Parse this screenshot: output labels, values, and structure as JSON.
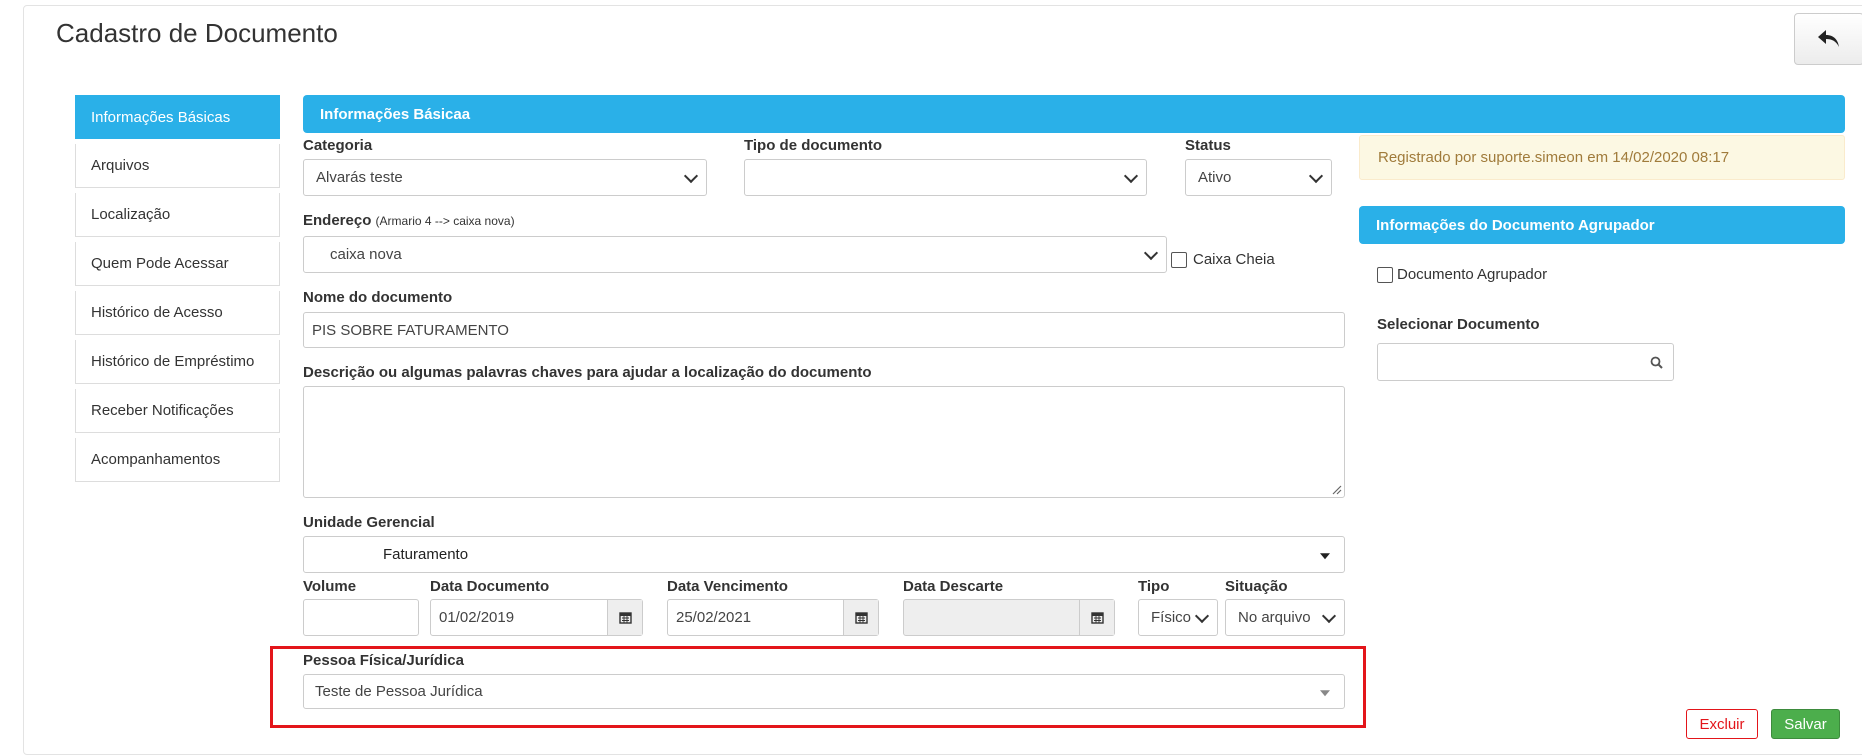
{
  "page": {
    "title": "Cadastro de Documento"
  },
  "sidebar": {
    "items": [
      {
        "label": "Informações Básicas"
      },
      {
        "label": "Arquivos"
      },
      {
        "label": "Localização"
      },
      {
        "label": "Quem Pode Acessar"
      },
      {
        "label": "Histórico de Acesso"
      },
      {
        "label": "Histórico de Empréstimo"
      },
      {
        "label": "Receber Notificações"
      },
      {
        "label": "Acompanhamentos"
      }
    ]
  },
  "main": {
    "header": "Informações Básicaa",
    "categoria": {
      "label": "Categoria",
      "value": "Alvarás teste"
    },
    "tipo_documento": {
      "label": "Tipo de documento",
      "value": ""
    },
    "status": {
      "label": "Status",
      "value": "Ativo"
    },
    "endereco": {
      "label": "Endereço",
      "hint": "(Armario 4 --> caixa nova)",
      "value": "caixa nova"
    },
    "caixa_cheia": {
      "label": "Caixa Cheia",
      "checked": false
    },
    "nome": {
      "label": "Nome do documento",
      "value": "PIS SOBRE FATURAMENTO"
    },
    "descricao": {
      "label": "Descrição ou algumas palavras chaves para ajudar a localização do documento",
      "value": ""
    },
    "unidade": {
      "label": "Unidade Gerencial",
      "value": "Faturamento"
    },
    "volume": {
      "label": "Volume",
      "value": ""
    },
    "data_documento": {
      "label": "Data Documento",
      "value": "01/02/2019"
    },
    "data_vencimento": {
      "label": "Data Vencimento",
      "value": "25/02/2021"
    },
    "data_descarte": {
      "label": "Data Descarte",
      "value": ""
    },
    "tipo": {
      "label": "Tipo",
      "value": "Físico"
    },
    "situacao": {
      "label": "Situação",
      "value": "No arquivo"
    },
    "pessoa": {
      "label": "Pessoa Física/Jurídica",
      "value": "Teste de Pessoa Jurídica"
    }
  },
  "right": {
    "registro": "Registrado por suporte.simeon em 14/02/2020 08:17",
    "header": "Informações do Documento Agrupador",
    "agrupador": {
      "label": "Documento Agrupador",
      "checked": false
    },
    "selecionar": {
      "label": "Selecionar Documento",
      "value": ""
    }
  },
  "actions": {
    "excluir": "Excluir",
    "salvar": "Salvar"
  },
  "colors": {
    "accent": "#2ab0e8",
    "danger": "#e3151a",
    "success": "#4cae4c",
    "warning_text": "#a07b3b"
  }
}
